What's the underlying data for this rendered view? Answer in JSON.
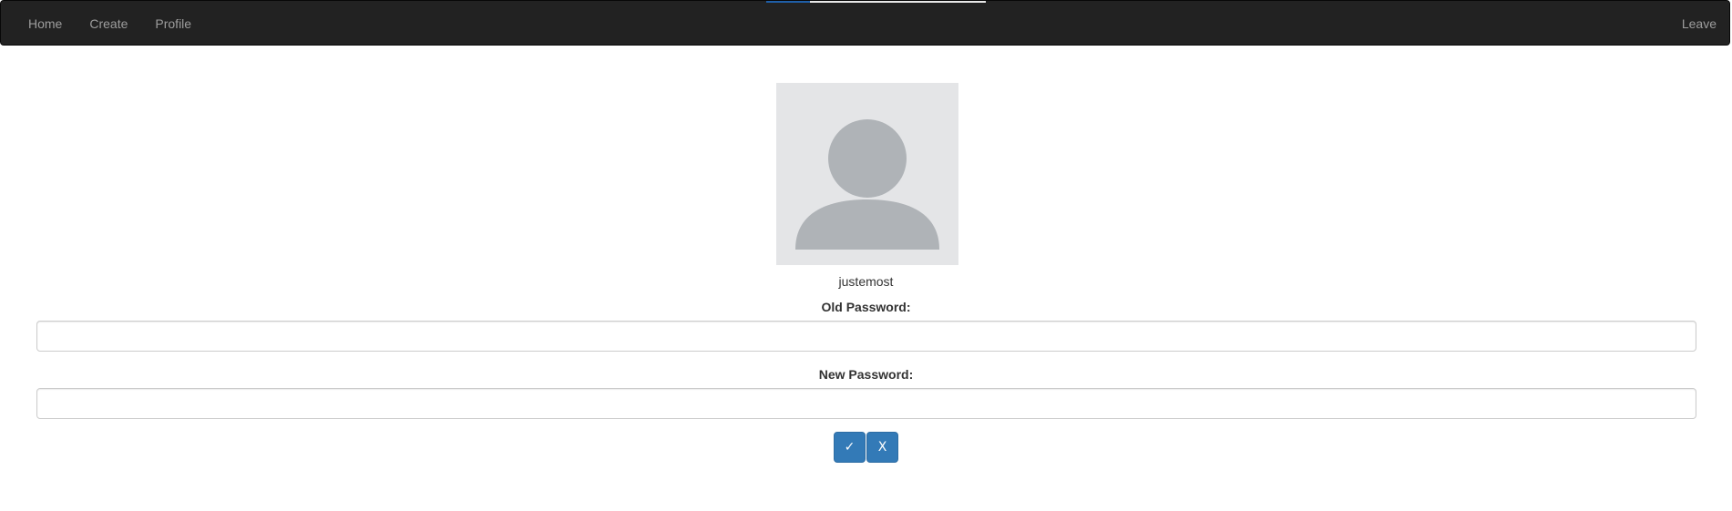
{
  "navbar": {
    "progress": 0.2,
    "items": [
      {
        "label": "Home"
      },
      {
        "label": "Create"
      },
      {
        "label": "Profile"
      }
    ],
    "right_item": {
      "label": "Leave"
    }
  },
  "profile": {
    "avatar_icon": "default-user-avatar-icon",
    "username": "justemost",
    "old_password_label": "Old Password:",
    "old_password_value": "",
    "new_password_label": "New Password:",
    "new_password_value": "",
    "confirm_label": "✓",
    "cancel_label": "X"
  },
  "colors": {
    "navbar_bg": "#222222",
    "nav_link": "#9d9d9d",
    "primary_button": "#337ab7",
    "avatar_bg": "#e4e5e7",
    "avatar_fg": "#afb3b7"
  }
}
